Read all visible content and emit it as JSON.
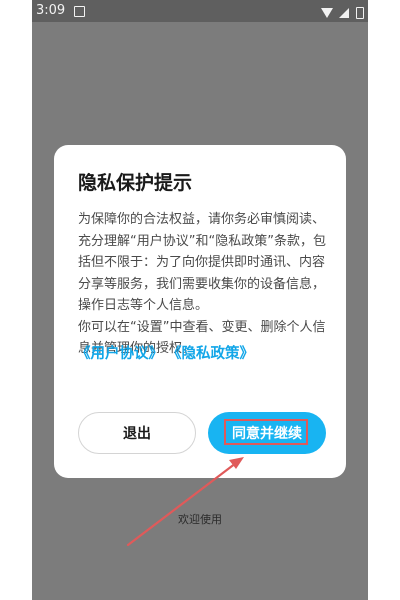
{
  "status_bar": {
    "time": "3:09",
    "icons": [
      "notification-icon",
      "wifi-icon",
      "signal-icon",
      "battery-icon"
    ]
  },
  "dialog": {
    "title": "隐私保护提示",
    "paragraph_1": "为保障你的合法权益，请你务必审慎阅读、充分理解“用户协议”和“隐私政策”条款，包括但不限于：为了向你提供即时通讯、内容分享等服务，我们需要收集你的设备信息，操作日志等个人信息。",
    "paragraph_2": "你可以在“设置”中查看、变更、删除个人信息并管理你的授权。",
    "links": {
      "user_agreement": "《用户协议》",
      "privacy_policy": "《隐私政策》"
    },
    "buttons": {
      "exit": "退出",
      "agree": "同意并继续"
    }
  },
  "footer": {
    "welcome": "欢迎使用"
  },
  "colors": {
    "overlay": "#7c7c7c",
    "accent": "#18b4f2",
    "link": "#12a6e8",
    "annotation": "#e05a5a"
  }
}
